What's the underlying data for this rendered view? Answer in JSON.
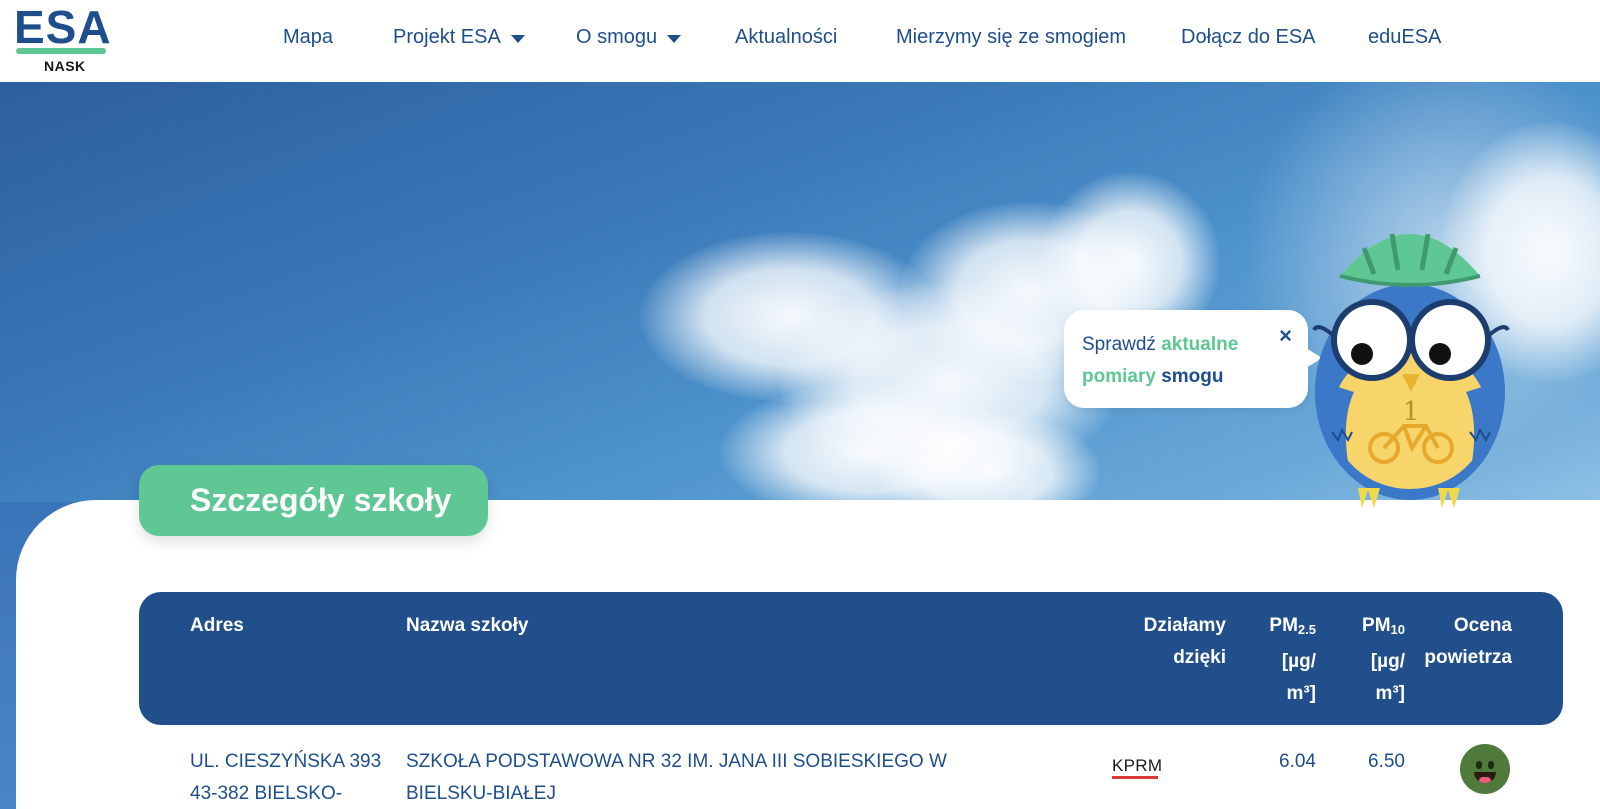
{
  "logo": {
    "main": "ESA",
    "sub": "NASK"
  },
  "nav": [
    {
      "label": "Mapa",
      "dropdown": false
    },
    {
      "label": "Projekt ESA",
      "dropdown": true
    },
    {
      "label": "O smogu",
      "dropdown": true
    },
    {
      "label": "Aktualności",
      "dropdown": false
    },
    {
      "label": "Mierzymy się ze smogiem",
      "dropdown": false
    },
    {
      "label": "Dołącz do ESA",
      "dropdown": false
    },
    {
      "label": "eduESA",
      "dropdown": false
    }
  ],
  "bubble": {
    "part1": "Sprawdź ",
    "part2": "aktualne",
    "part3": "pomiary",
    "part4": " smogu",
    "close": "×"
  },
  "section_title": "Szczegóły szkoły",
  "table": {
    "headers": {
      "address": "Adres",
      "school_name": "Nazwa szkoły",
      "sponsor_line1": "Działamy",
      "sponsor_line2": "dzięki",
      "pm25_main": "PM",
      "pm25_sub": "2.5",
      "pm25_unit_line1": "[µg/",
      "pm25_unit_line2": "m³]",
      "pm10_main": "PM",
      "pm10_sub": "10",
      "pm10_unit_line1": "[µg/",
      "pm10_unit_line2": "m³]",
      "rating_line1": "Ocena",
      "rating_line2": "powietrza"
    },
    "rows": [
      {
        "address_line1": "ul. Cieszyńska 393",
        "address_line2": "43-382 Bielsko-",
        "school_line1": "Szkoła Podstawowa nr 32 im. Jana III Sobieskiego w",
        "school_line2": "Bielsku-Białej",
        "sponsor": "KPRM",
        "pm25": "6.04",
        "pm10": "6.50",
        "rating_icon": "smiling-face-good-air-icon"
      }
    ]
  },
  "colors": {
    "brand_blue": "#1e4f8c",
    "table_header": "#214f8b",
    "accent_green": "#5ec794",
    "rating_good": "#4f7a3c"
  }
}
